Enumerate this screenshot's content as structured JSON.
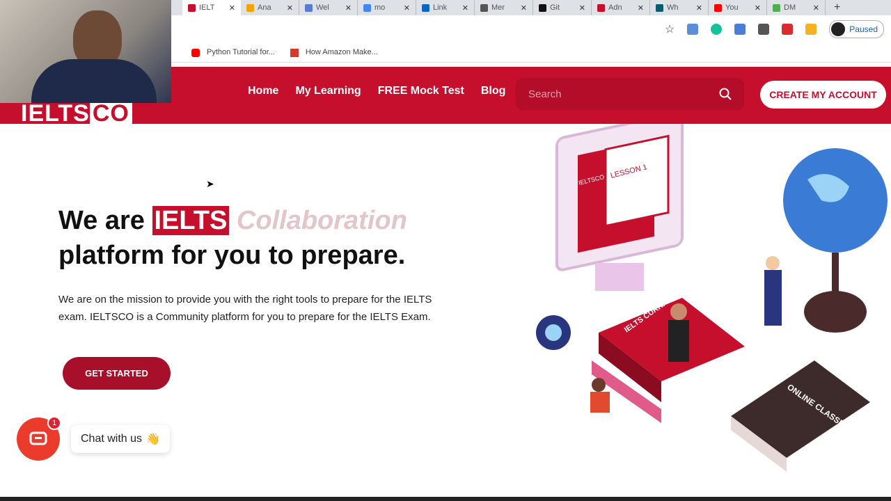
{
  "browser": {
    "tabs": [
      {
        "label": "IELT",
        "color": "#c60f2d",
        "active": true
      },
      {
        "label": "Ana",
        "color": "#f4a300"
      },
      {
        "label": "Wel",
        "color": "#5a7bd5"
      },
      {
        "label": "mo",
        "color": "#4285f4"
      },
      {
        "label": "Link",
        "color": "#0a66c2"
      },
      {
        "label": "Mer",
        "color": "#555555"
      },
      {
        "label": "Git",
        "color": "#111111"
      },
      {
        "label": "Adn",
        "color": "#c60f2d"
      },
      {
        "label": "Wh",
        "color": "#0b5d6b"
      },
      {
        "label": "You",
        "color": "#ff0000"
      },
      {
        "label": "DM",
        "color": "#4caf50"
      }
    ],
    "new_tab": "+",
    "profile_status": "Paused",
    "bookmarks": [
      {
        "label": "Python Tutorial for...",
        "color": "#ff0000"
      },
      {
        "label": "How Amazon Make...",
        "color": "#d8382a"
      }
    ]
  },
  "site": {
    "logo": "IELTSCO",
    "nav": [
      "Home",
      "My Learning",
      "FREE Mock Test",
      "Blog"
    ],
    "search_placeholder": "Search",
    "cta": "CREATE MY ACCOUNT",
    "hero": {
      "line1_prefix": "We are",
      "highlight": "IELTS",
      "typing": "Collaboration",
      "line2": "platform for you to prepare.",
      "description": "We are on the mission to provide you with the right tools to prepare for the IELTS exam. IELTSCO is a Community platform for you to prepare for the IELTS Exam.",
      "button": "GET STARTED"
    },
    "illustration": {
      "lesson": "LESSON 1",
      "book1": "IELTS CURRICULUM",
      "book2": "ONLINE CLASSES",
      "screen": "IELTSCO"
    },
    "chat": {
      "label": "Chat with us",
      "emoji": "👋",
      "badge": "1"
    },
    "colors": {
      "brand": "#c60f2d",
      "button": "#a80f2a"
    }
  }
}
